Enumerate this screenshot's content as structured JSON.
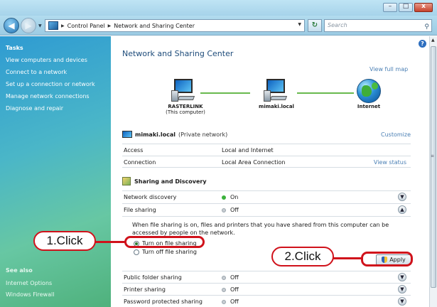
{
  "window": {
    "min_glyph": "–",
    "max_glyph": "□",
    "close_glyph": "x"
  },
  "address": {
    "crumbs": [
      "Control Panel",
      "Network and Sharing Center"
    ],
    "search_placeholder": "Search"
  },
  "sidebar": {
    "tasks_title": "Tasks",
    "tasks": [
      "View computers and devices",
      "Connect to a network",
      "Set up a connection or network",
      "Manage network connections",
      "Diagnose and repair"
    ],
    "see_also_title": "See also",
    "see_also": [
      "Internet Options",
      "Windows Firewall"
    ]
  },
  "main": {
    "title": "Network and Sharing Center",
    "view_full_map": "View full map",
    "map": {
      "computer_name": "RASTERLINK",
      "computer_sub": "(This computer)",
      "network_name": "mimaki.local",
      "internet": "Internet"
    },
    "network": {
      "name": "mimaki.local",
      "type": "(Private network)",
      "customize": "Customize",
      "access_label": "Access",
      "access_value": "Local and Internet",
      "connection_label": "Connection",
      "connection_value": "Local Area Connection",
      "view_status": "View status"
    },
    "sharing": {
      "title": "Sharing and Discovery",
      "rows": [
        {
          "label": "Network discovery",
          "status": "On"
        },
        {
          "label": "File sharing",
          "status": "Off"
        }
      ],
      "description": "When file sharing is on, files and printers that you have shared from this computer can be accessed by people on the network.",
      "option_on": "Turn on file sharing",
      "option_off": "Turn off file sharing",
      "apply": "Apply",
      "lower_rows": [
        {
          "label": "Public folder sharing",
          "status": "Off"
        },
        {
          "label": "Printer sharing",
          "status": "Off"
        },
        {
          "label": "Password protected sharing",
          "status": "Off"
        }
      ]
    }
  },
  "annotations": {
    "click1": "1.Click",
    "click2": "2.Click"
  },
  "colors": {
    "callout_red": "#d0121b",
    "status_on": "#3cb13c",
    "link_blue": "#4a7fb4"
  }
}
